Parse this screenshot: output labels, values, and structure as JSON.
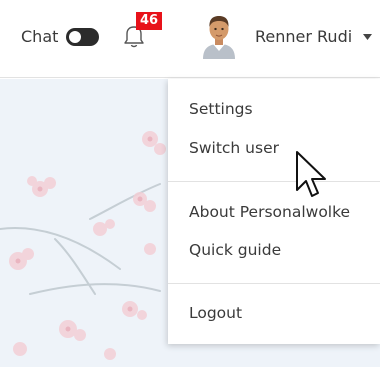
{
  "topbar": {
    "chat_label": "Chat",
    "chat_toggle_state": "on",
    "notifications_count": "46",
    "user_name": "Renner Rudi"
  },
  "menu": {
    "items": [
      {
        "label": "Settings"
      },
      {
        "label": "Switch user"
      },
      {
        "label": "About Personalwolke"
      },
      {
        "label": "Quick guide"
      },
      {
        "label": "Logout"
      }
    ]
  },
  "colors": {
    "badge": "#e8121a",
    "toggle": "#2b2b2b",
    "text": "#3a3a3a",
    "background_tint": "#eef3f9"
  },
  "icons": {
    "notifications": "bell-icon",
    "user_menu": "caret-down-icon",
    "pointer": "mouse-cursor-icon"
  }
}
